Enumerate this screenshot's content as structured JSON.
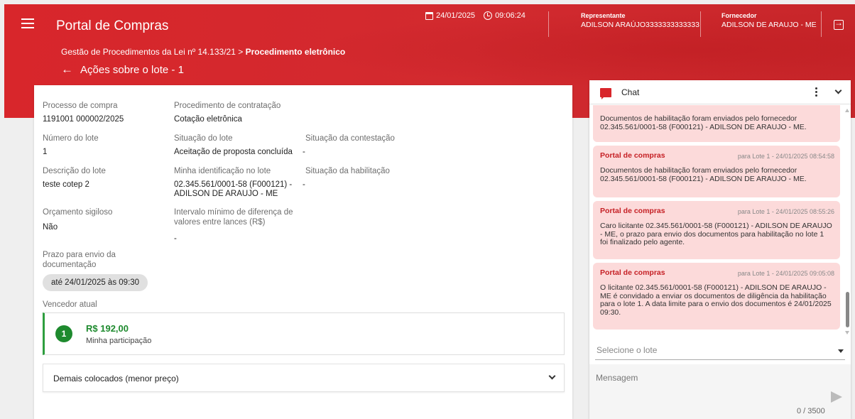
{
  "header": {
    "app_title": "Portal de Compras",
    "date": "24/01/2025",
    "time": "09:06:24",
    "representante_label": "Representante",
    "representante_value": "ADILSON ARAÚJO3333333333333",
    "fornecedor_label": "Fornecedor",
    "fornecedor_value": "ADILSON DE ARAUJO - ME",
    "breadcrumb_parent": "Gestão de Procedimentos da Lei nº 14.133/21 > ",
    "breadcrumb_current": "Procedimento eletrônico",
    "page_title": "Ações sobre o lote - 1"
  },
  "details": {
    "processo_label": "Processo de compra",
    "processo_value": "1191001 000002/2025",
    "procedimento_label": "Procedimento de contratação",
    "procedimento_value": "Cotação eletrônica",
    "numero_lote_label": "Número do lote",
    "numero_lote_value": "1",
    "situacao_lote_label": "Situação do lote",
    "situacao_lote_value": "Aceitação de proposta concluída",
    "situacao_contestacao_label": "Situação da contestação",
    "situacao_contestacao_value": "-",
    "descricao_label": "Descrição do lote",
    "descricao_value": "teste cotep 2",
    "identificacao_label": "Minha identificação no lote",
    "identificacao_value_1": "02.345.561/0001-58 (F000121) -",
    "identificacao_value_2": "ADILSON DE ARAUJO - ME",
    "situacao_habilitacao_label": "Situação da habilitação",
    "situacao_habilitacao_value": "-",
    "orcamento_label": "Orçamento sigiloso",
    "orcamento_value": "Não",
    "intervalo_label_1": "Intervalo mínimo de diferença de",
    "intervalo_label_2": "valores entre lances (R$)",
    "intervalo_value": "-",
    "prazo_label_1": "Prazo para envio da",
    "prazo_label_2": "documentação",
    "prazo_value": "até 24/01/2025 às 09:30",
    "vencedor_label": "Vencedor atual"
  },
  "winner": {
    "position": "1",
    "amount": "R$ 192,00",
    "subtitle": "Minha participação"
  },
  "accordion": {
    "label": "Demais colocados (menor preço)"
  },
  "chat": {
    "title": "Chat",
    "messages": [
      {
        "sender": "",
        "meta": "",
        "body": "Documentos de habilitação foram enviados pelo fornecedor 02.345.561/0001-58 (F000121) - ADILSON DE ARAUJO - ME."
      },
      {
        "sender": "Portal de compras",
        "meta": "para Lote 1  -  24/01/2025 08:54:58",
        "body": "Documentos de habilitação foram enviados pelo fornecedor 02.345.561/0001-58 (F000121) - ADILSON DE ARAUJO - ME."
      },
      {
        "sender": "Portal de compras",
        "meta": "para Lote 1  -  24/01/2025 08:55:26",
        "body": "Caro licitante 02.345.561/0001-58 (F000121) - ADILSON DE ARAUJO - ME, o prazo para envio dos documentos para habilitação no lote  1 foi finalizado pelo agente."
      },
      {
        "sender": "Portal de compras",
        "meta": "para Lote 1  -  24/01/2025 09:05:08",
        "body": "O licitante 02.345.561/0001-58 (F000121) - ADILSON DE ARAUJO - ME é convidado a enviar os documentos de diligência da habilitação para o lote  1. A data limite para o envio dos documentos é 24/01/2025 09:30."
      }
    ],
    "lot_placeholder": "Selecione o lote",
    "message_placeholder": "Mensagem",
    "counter": "0 / 3500"
  },
  "colors": {
    "header_red": "#d8262b",
    "message_bg": "#fcdada",
    "winner_green": "#1e8a2e"
  }
}
